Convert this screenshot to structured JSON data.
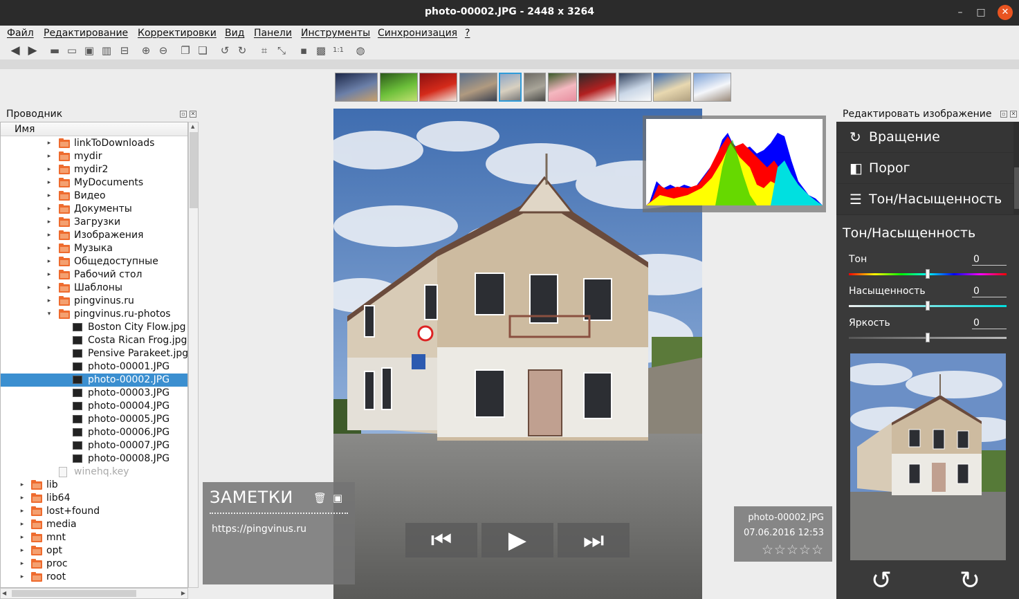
{
  "window": {
    "title": "photo-00002.JPG  - 2448 x 3264"
  },
  "menu": [
    "Файл",
    "Редактирование",
    "Корректировки",
    "Вид",
    "Панели",
    "Инструменты",
    "Синхронизация",
    "?"
  ],
  "toolbar_icons": [
    "back-arrow-icon",
    "forward-arrow-icon",
    "open-folder-icon",
    "folder-icon",
    "save-icon",
    "delete-icon",
    "delete-all-icon",
    "zoom-in-icon",
    "zoom-out-icon",
    "copy-icon",
    "paste-icon",
    "rotate-left-icon",
    "rotate-right-icon",
    "crop-icon",
    "resize-icon",
    "fit-window-icon",
    "fit-width-icon",
    "actual-size-icon",
    "web-icon"
  ],
  "thumbs": [
    {
      "name": "night-city",
      "colors": [
        "#1c2748",
        "#6b7fa8",
        "#c9a06a"
      ]
    },
    {
      "name": "frog",
      "colors": [
        "#2c5a1a",
        "#6cbf3a",
        "#c0e070"
      ]
    },
    {
      "name": "chess",
      "colors": [
        "#8a0f10",
        "#d42a1a",
        "#f0e8e0"
      ]
    },
    {
      "name": "sunset-sea",
      "colors": [
        "#5a6f8c",
        "#b09a80",
        "#3a4150"
      ]
    },
    {
      "name": "house",
      "colors": [
        "#8da6c8",
        "#d8d0c0",
        "#7a7a7a"
      ]
    },
    {
      "name": "castle",
      "colors": [
        "#6d6b65",
        "#a8a498",
        "#4a4a48"
      ]
    },
    {
      "name": "rose",
      "colors": [
        "#3a5a2a",
        "#f4b8c0",
        "#e88fa0"
      ]
    },
    {
      "name": "train",
      "colors": [
        "#2a2a2a",
        "#b22020",
        "#ffffff"
      ]
    },
    {
      "name": "snow-river",
      "colors": [
        "#2e3e5a",
        "#c9d6e6",
        "#fafafa"
      ]
    },
    {
      "name": "town-square",
      "colors": [
        "#3a6ab0",
        "#e8d8b0",
        "#b0a080"
      ]
    },
    {
      "name": "snow-trees",
      "colors": [
        "#7aa0d6",
        "#f4f6fa",
        "#9a8a7a"
      ]
    }
  ],
  "left_dock": {
    "title": "Проводник",
    "column": "Имя",
    "rows": [
      {
        "label": "linkToDownloads",
        "type": "folder",
        "indent": 1,
        "arrow": "▸"
      },
      {
        "label": "mydir",
        "type": "folder",
        "indent": 1,
        "arrow": "▸"
      },
      {
        "label": "mydir2",
        "type": "folder",
        "indent": 1,
        "arrow": "▸"
      },
      {
        "label": "MyDocuments",
        "type": "folder",
        "indent": 1,
        "arrow": "▸"
      },
      {
        "label": "Видео",
        "type": "folder",
        "indent": 1,
        "arrow": "▸"
      },
      {
        "label": "Документы",
        "type": "folder",
        "indent": 1,
        "arrow": "▸"
      },
      {
        "label": "Загрузки",
        "type": "folder",
        "indent": 1,
        "arrow": "▸"
      },
      {
        "label": "Изображения",
        "type": "folder",
        "indent": 1,
        "arrow": "▸"
      },
      {
        "label": "Музыка",
        "type": "folder",
        "indent": 1,
        "arrow": "▸"
      },
      {
        "label": "Общедоступные",
        "type": "folder",
        "indent": 1,
        "arrow": "▸"
      },
      {
        "label": "Рабочий стол",
        "type": "folder",
        "indent": 1,
        "arrow": "▸"
      },
      {
        "label": "Шаблоны",
        "type": "folder",
        "indent": 1,
        "arrow": "▸"
      },
      {
        "label": "pingvinus.ru",
        "type": "folder",
        "indent": 1,
        "arrow": "▸"
      },
      {
        "label": "pingvinus.ru-photos",
        "type": "folder",
        "indent": 1,
        "arrow": "▾"
      },
      {
        "label": "Boston City Flow.jpg",
        "type": "image",
        "indent": 2,
        "arrow": ""
      },
      {
        "label": "Costa Rican Frog.jpg",
        "type": "image",
        "indent": 2,
        "arrow": ""
      },
      {
        "label": "Pensive Parakeet.jpg",
        "type": "image",
        "indent": 2,
        "arrow": ""
      },
      {
        "label": "photo-00001.JPG",
        "type": "image",
        "indent": 2,
        "arrow": ""
      },
      {
        "label": "photo-00002.JPG",
        "type": "image",
        "indent": 2,
        "arrow": "",
        "selected": true
      },
      {
        "label": "photo-00003.JPG",
        "type": "image",
        "indent": 2,
        "arrow": ""
      },
      {
        "label": "photo-00004.JPG",
        "type": "image",
        "indent": 2,
        "arrow": ""
      },
      {
        "label": "photo-00005.JPG",
        "type": "image",
        "indent": 2,
        "arrow": ""
      },
      {
        "label": "photo-00006.JPG",
        "type": "image",
        "indent": 2,
        "arrow": ""
      },
      {
        "label": "photo-00007.JPG",
        "type": "image",
        "indent": 2,
        "arrow": ""
      },
      {
        "label": "photo-00008.JPG",
        "type": "image",
        "indent": 2,
        "arrow": ""
      },
      {
        "label": "winehq.key",
        "type": "doc",
        "indent": 1,
        "arrow": "",
        "dim": true
      },
      {
        "label": "lib",
        "type": "folder",
        "indent": 0,
        "arrow": "▸"
      },
      {
        "label": "lib64",
        "type": "folder",
        "indent": 0,
        "arrow": "▸"
      },
      {
        "label": "lost+found",
        "type": "folder",
        "indent": 0,
        "arrow": "▸"
      },
      {
        "label": "media",
        "type": "folder",
        "indent": 0,
        "arrow": "▸"
      },
      {
        "label": "mnt",
        "type": "folder",
        "indent": 0,
        "arrow": "▸"
      },
      {
        "label": "opt",
        "type": "folder",
        "indent": 0,
        "arrow": "▸"
      },
      {
        "label": "proc",
        "type": "folder",
        "indent": 0,
        "arrow": "▸"
      },
      {
        "label": "root",
        "type": "folder",
        "indent": 0,
        "arrow": "▸"
      }
    ]
  },
  "notes": {
    "title": "ЗАМЕТКИ",
    "text": "https://pingvinus.ru"
  },
  "player": {
    "prev": "⏮",
    "play": "▶",
    "next": "⏭"
  },
  "info": {
    "filename": "photo-00002.JPG",
    "datetime": "07.06.2016 12:53",
    "rating": "☆☆☆☆☆"
  },
  "right_dock": {
    "title": "Редактировать изображение",
    "buttons": [
      {
        "label": "Вращение",
        "icon": "rotate-icon",
        "glyph": "↻"
      },
      {
        "label": "Порог",
        "icon": "threshold-icon",
        "glyph": "◧"
      },
      {
        "label": "Тон/Насыщенность",
        "icon": "sliders-icon",
        "glyph": "☰"
      }
    ],
    "section_title": "Тон/Насыщенность",
    "sliders": [
      {
        "label": "Тон",
        "value": "0",
        "level": 0.5
      },
      {
        "label": "Насыщенность",
        "value": "0",
        "level": 0.5
      },
      {
        "label": "Яркость",
        "value": "0",
        "level": 0.5
      }
    ],
    "rotate_left": "↺",
    "rotate_right": "↻"
  }
}
